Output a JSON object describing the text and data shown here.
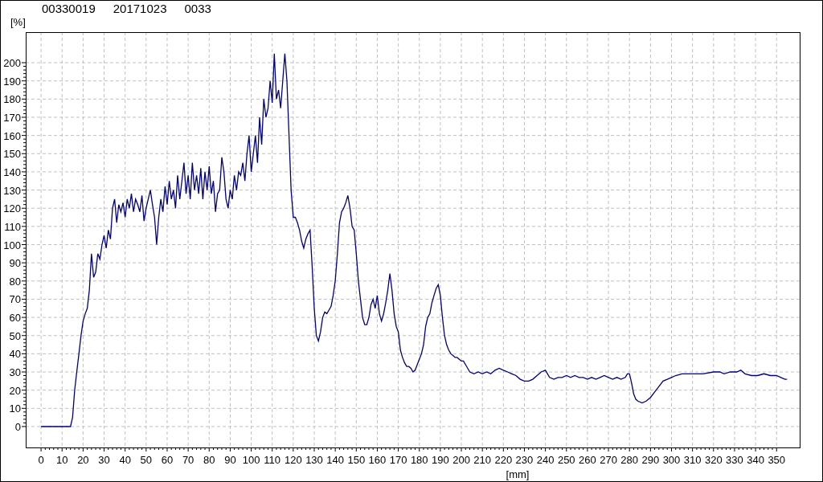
{
  "header": {
    "fields": [
      "00330019",
      "20171023",
      "0033"
    ]
  },
  "chart": {
    "chart_data": {
      "type": "line",
      "grid": true,
      "xlabel": "[mm]",
      "ylabel": "[%]",
      "xlim": [
        -7.3,
        361
      ],
      "ylim": [
        -11.5,
        216.8
      ],
      "xticks": [
        0,
        10,
        20,
        30,
        40,
        50,
        60,
        70,
        80,
        90,
        100,
        110,
        120,
        130,
        140,
        150,
        160,
        170,
        180,
        190,
        200,
        210,
        220,
        230,
        240,
        250,
        260,
        270,
        280,
        290,
        300,
        310,
        320,
        330,
        340,
        350
      ],
      "yticks": [
        0,
        10,
        20,
        30,
        40,
        50,
        60,
        70,
        80,
        90,
        100,
        110,
        120,
        130,
        140,
        150,
        160,
        170,
        180,
        190,
        200
      ],
      "x": [
        0,
        1,
        2,
        3,
        4,
        5,
        6,
        7,
        8,
        9,
        10,
        11,
        12,
        13,
        14,
        15,
        16,
        17,
        18,
        19,
        20,
        21,
        22,
        23,
        24,
        25,
        26,
        27,
        28,
        29,
        30,
        31,
        32,
        33,
        34,
        35,
        36,
        37,
        38,
        39,
        40,
        41,
        42,
        43,
        44,
        45,
        46,
        47,
        48,
        49,
        50,
        51,
        52,
        53,
        54,
        55,
        56,
        57,
        58,
        59,
        60,
        61,
        62,
        63,
        64,
        65,
        66,
        67,
        68,
        69,
        70,
        71,
        72,
        73,
        74,
        75,
        76,
        77,
        78,
        79,
        80,
        81,
        82,
        83,
        84,
        85,
        86,
        87,
        88,
        89,
        90,
        91,
        92,
        93,
        94,
        95,
        96,
        97,
        98,
        99,
        100,
        101,
        102,
        103,
        104,
        105,
        106,
        107,
        108,
        109,
        110,
        111,
        112,
        113,
        114,
        115,
        116,
        117,
        118,
        119,
        120,
        121,
        122,
        123,
        124,
        125,
        126,
        127,
        128,
        129,
        130,
        131,
        132,
        133,
        134,
        135,
        136,
        137,
        138,
        139,
        140,
        141,
        142,
        143,
        144,
        145,
        146,
        147,
        148,
        149,
        150,
        151,
        152,
        153,
        154,
        155,
        156,
        157,
        158,
        159,
        160,
        161,
        162,
        163,
        164,
        165,
        166,
        167,
        168,
        169,
        170,
        171,
        172,
        173,
        174,
        175,
        176,
        177,
        178,
        179,
        180,
        181,
        182,
        183,
        184,
        185,
        186,
        187,
        188,
        189,
        190,
        191,
        192,
        193,
        194,
        195,
        196,
        197,
        198,
        199,
        200,
        201,
        202,
        203,
        204,
        206,
        208,
        210,
        212,
        214,
        216,
        218,
        220,
        222,
        224,
        226,
        228,
        230,
        232,
        234,
        236,
        238,
        240,
        242,
        244,
        246,
        248,
        250,
        252,
        254,
        256,
        258,
        260,
        262,
        264,
        266,
        268,
        270,
        272,
        274,
        276,
        278,
        279,
        280,
        281,
        282,
        283,
        284,
        286,
        288,
        290,
        292,
        294,
        296,
        298,
        300,
        302,
        305,
        310,
        315,
        320,
        323,
        325,
        328,
        331,
        333,
        335,
        338,
        341,
        344,
        347,
        350,
        352,
        354,
        355
      ],
      "series": [
        {
          "color": "#000080",
          "values": [
            0,
            0,
            0,
            0,
            0,
            0,
            0,
            0,
            0,
            0,
            0,
            0,
            0,
            0,
            0,
            5,
            20,
            30,
            40,
            50,
            58,
            62,
            65,
            75,
            95,
            82,
            85,
            95,
            92,
            100,
            105,
            98,
            108,
            103,
            120,
            125,
            112,
            122,
            118,
            123,
            115,
            125,
            120,
            128,
            118,
            125,
            122,
            118,
            127,
            113,
            120,
            125,
            130,
            122,
            115,
            100,
            115,
            125,
            118,
            132,
            122,
            135,
            125,
            130,
            120,
            138,
            125,
            135,
            145,
            128,
            138,
            125,
            145,
            130,
            138,
            128,
            142,
            125,
            140,
            130,
            143,
            128,
            135,
            118,
            128,
            130,
            148,
            140,
            125,
            120,
            130,
            125,
            138,
            130,
            140,
            138,
            145,
            135,
            150,
            160,
            140,
            150,
            160,
            145,
            170,
            155,
            180,
            170,
            175,
            190,
            178,
            205,
            180,
            185,
            175,
            190,
            205,
            190,
            160,
            130,
            115,
            115,
            112,
            108,
            102,
            98,
            103,
            106,
            108,
            88,
            65,
            50,
            47,
            52,
            60,
            63,
            62,
            64,
            66,
            72,
            80,
            95,
            112,
            118,
            120,
            123,
            127,
            120,
            110,
            108,
            95,
            80,
            70,
            60,
            56,
            56,
            60,
            67,
            70,
            65,
            72,
            62,
            58,
            62,
            68,
            75,
            84,
            75,
            62,
            55,
            52,
            42,
            38,
            35,
            33,
            33,
            32,
            30,
            31,
            34,
            37,
            40,
            45,
            55,
            60,
            62,
            68,
            72,
            76,
            78,
            72,
            60,
            50,
            45,
            42,
            40,
            39,
            38,
            38,
            37,
            36,
            36,
            34,
            32,
            30,
            29,
            30,
            29,
            30,
            29,
            31,
            32,
            31,
            30,
            29,
            28,
            26,
            25,
            25,
            26,
            28,
            30,
            31,
            27,
            26,
            27,
            27,
            28,
            27,
            28,
            27,
            27,
            26,
            27,
            26,
            27,
            28,
            27,
            26,
            27,
            26,
            27,
            29,
            29,
            24,
            18,
            15,
            14,
            13,
            14,
            16,
            19,
            22,
            25,
            26,
            27,
            28,
            29,
            29,
            29,
            30,
            30,
            29,
            30,
            30,
            31,
            29,
            28,
            28,
            29,
            28,
            28,
            27,
            26,
            26
          ]
        }
      ]
    }
  }
}
